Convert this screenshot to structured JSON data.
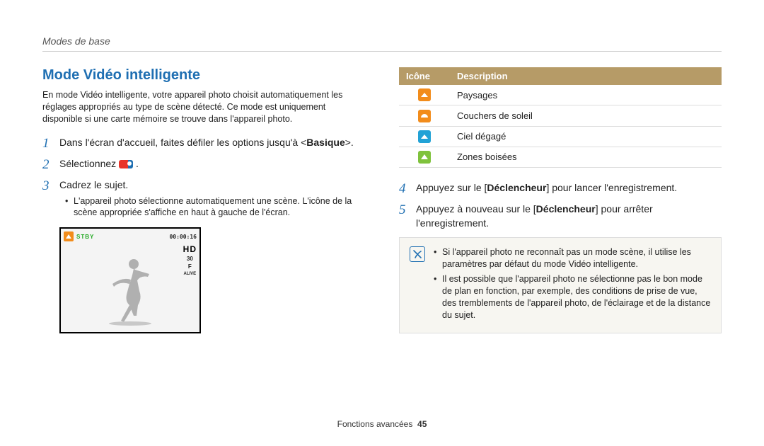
{
  "breadcrumb": "Modes de base",
  "section_title": "Mode Vidéo intelligente",
  "intro": "En mode Vidéo intelligente, votre appareil photo choisit automatiquement les réglages appropriés au type de scène détecté. Ce mode est uniquement disponible si une carte mémoire se trouve dans l'appareil photo.",
  "steps_left": {
    "s1_a": "Dans l'écran d'accueil, faites défiler les options jusqu'à <",
    "s1_b": "Basique",
    "s1_c": ">.",
    "s2_a": "Sélectionnez ",
    "s2_b": " .",
    "s3": "Cadrez le sujet.",
    "s3_sub": "L'appareil photo sélectionne automatiquement une scène. L'icône de la scène appropriée s'affiche en haut à gauche de l'écran."
  },
  "camera": {
    "stby": "STBY",
    "time": "00:00:16",
    "hd": "HD",
    "fps": "30",
    "f": "F",
    "rec": "ALIVE"
  },
  "table": {
    "head_icon": "Icône",
    "head_desc": "Description",
    "rows": [
      {
        "icon": "landscape",
        "label": "Paysages"
      },
      {
        "icon": "sunset",
        "label": "Couchers de soleil"
      },
      {
        "icon": "sky",
        "label": "Ciel dégagé"
      },
      {
        "icon": "forest",
        "label": "Zones boisées"
      }
    ]
  },
  "steps_right": {
    "s4_a": "Appuyez sur le [",
    "s4_b": "Déclencheur",
    "s4_c": "] pour lancer l'enregistrement.",
    "s5_a": "Appuyez à nouveau sur le [",
    "s5_b": "Déclencheur",
    "s5_c": "] pour arrêter l'enregistrement."
  },
  "note": {
    "n1": "Si l'appareil photo ne reconnaît pas un mode scène, il utilise les paramètres par défaut du mode Vidéo intelligente.",
    "n2": "Il est possible que l'appareil photo ne sélectionne pas le bon mode de plan en fonction, par exemple, des conditions de prise de vue, des tremblements de l'appareil photo, de l'éclairage et de la distance du sujet."
  },
  "footer": {
    "section": "Fonctions avancées",
    "page": "45"
  }
}
